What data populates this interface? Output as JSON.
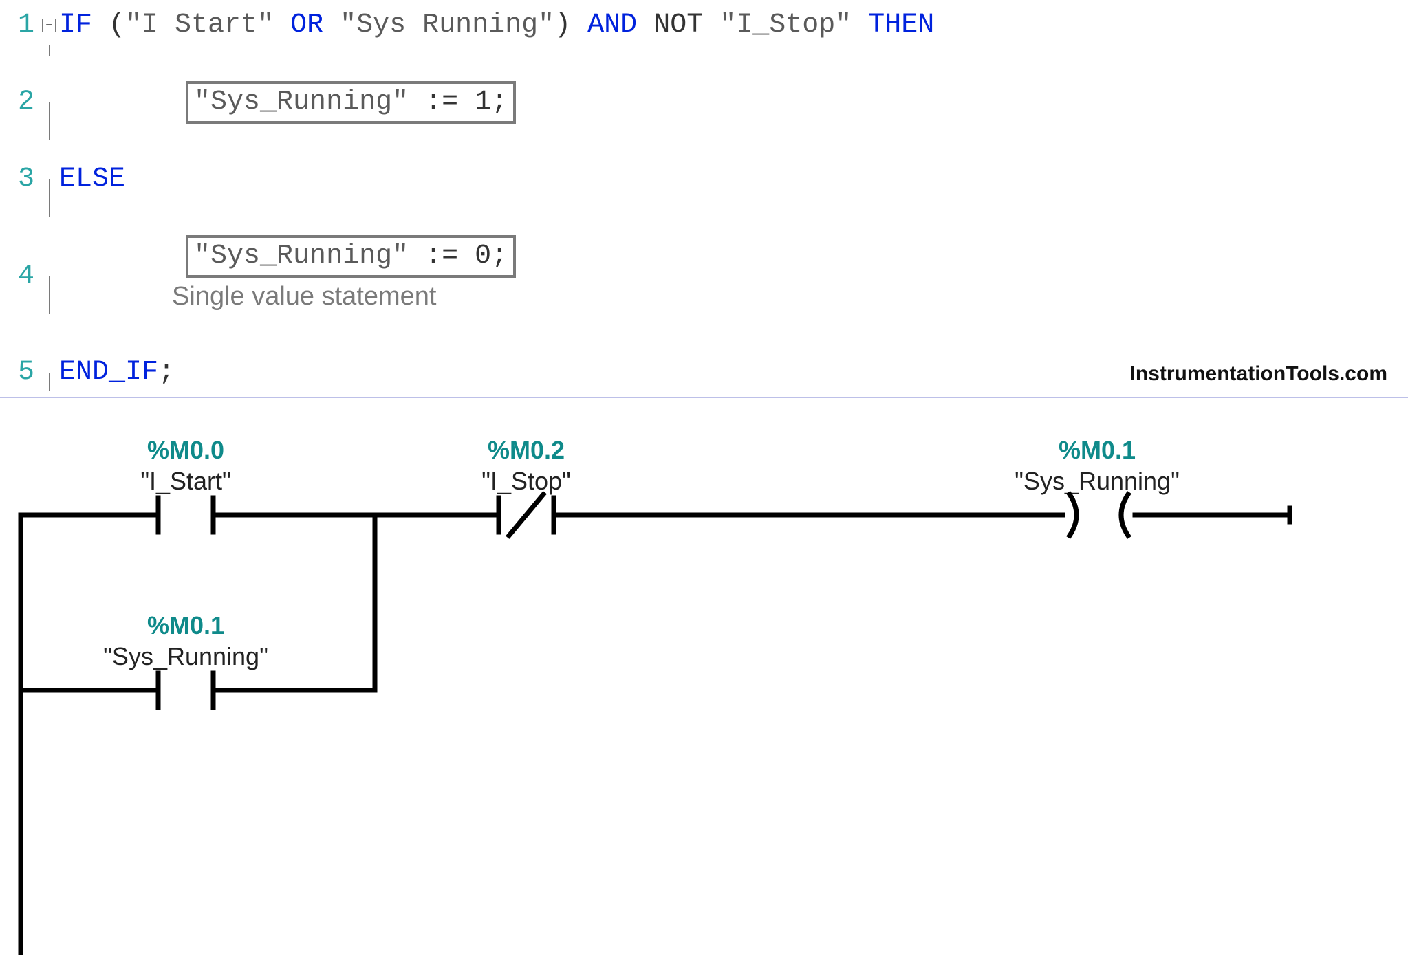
{
  "code": {
    "lines": [
      "1",
      "2",
      "3",
      "4",
      "5"
    ],
    "fold_symbol": "−",
    "line1": {
      "if": "IF",
      "lp": " (",
      "a": "\"I Start\"",
      "or": " OR ",
      "b": "\"Sys Running\"",
      "rp": ") ",
      "and": "AND",
      "not": " NOT ",
      "c": "\"I_Stop\"",
      "then": " THEN"
    },
    "line2_var": "\"Sys_Running\"",
    "line2_assign": " := 1;",
    "line3_else": "ELSE",
    "line4_var": "\"Sys_Running\"",
    "line4_assign": " := 0;",
    "line5_endif": "END_IF",
    "line5_semi": ";",
    "annotation": "Single value statement"
  },
  "watermark": "InstrumentationTools.com",
  "ladder": {
    "start": {
      "addr": "%M0.0",
      "tag": "\"I_Start\""
    },
    "stop": {
      "addr": "%M0.2",
      "tag": "\"I_Stop\""
    },
    "running_out": {
      "addr": "%M0.1",
      "tag": "\"Sys_Running\""
    },
    "running_latch": {
      "addr": "%M0.1",
      "tag": "\"Sys_Running\""
    }
  }
}
